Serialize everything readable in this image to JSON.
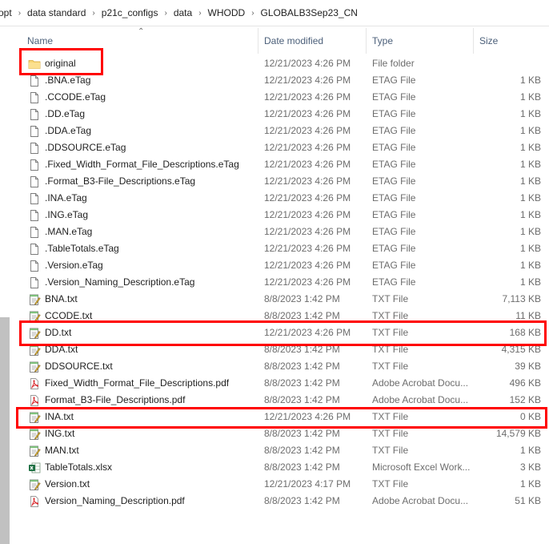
{
  "breadcrumb": [
    "opt",
    "data standard",
    "p21c_configs",
    "data",
    "WHODD",
    "GLOBALB3Sep23_CN"
  ],
  "columns": {
    "name": "Name",
    "date": "Date modified",
    "type": "Type",
    "size": "Size"
  },
  "icons": {
    "folder": "folder-icon",
    "file": "file-icon",
    "txt": "notepad-icon",
    "pdf": "pdf-icon",
    "xlsx": "excel-icon",
    "separator": "chevron-right-icon",
    "sort": "sort-up-icon"
  },
  "colors": {
    "highlight": "#ff0000",
    "folder": "#f8d775",
    "pdf": "#d8262b",
    "excel": "#1d6f42",
    "header_text": "#4c607a"
  },
  "files": [
    {
      "name": "original",
      "date": "12/21/2023 4:26 PM",
      "type": "File folder",
      "size": "",
      "icon": "folder"
    },
    {
      "name": ".BNA.eTag",
      "date": "12/21/2023 4:26 PM",
      "type": "ETAG File",
      "size": "1 KB",
      "icon": "file"
    },
    {
      "name": ".CCODE.eTag",
      "date": "12/21/2023 4:26 PM",
      "type": "ETAG File",
      "size": "1 KB",
      "icon": "file"
    },
    {
      "name": ".DD.eTag",
      "date": "12/21/2023 4:26 PM",
      "type": "ETAG File",
      "size": "1 KB",
      "icon": "file"
    },
    {
      "name": ".DDA.eTag",
      "date": "12/21/2023 4:26 PM",
      "type": "ETAG File",
      "size": "1 KB",
      "icon": "file"
    },
    {
      "name": ".DDSOURCE.eTag",
      "date": "12/21/2023 4:26 PM",
      "type": "ETAG File",
      "size": "1 KB",
      "icon": "file"
    },
    {
      "name": ".Fixed_Width_Format_File_Descriptions.eTag",
      "date": "12/21/2023 4:26 PM",
      "type": "ETAG File",
      "size": "1 KB",
      "icon": "file"
    },
    {
      "name": ".Format_B3-File_Descriptions.eTag",
      "date": "12/21/2023 4:26 PM",
      "type": "ETAG File",
      "size": "1 KB",
      "icon": "file"
    },
    {
      "name": ".INA.eTag",
      "date": "12/21/2023 4:26 PM",
      "type": "ETAG File",
      "size": "1 KB",
      "icon": "file"
    },
    {
      "name": ".ING.eTag",
      "date": "12/21/2023 4:26 PM",
      "type": "ETAG File",
      "size": "1 KB",
      "icon": "file"
    },
    {
      "name": ".MAN.eTag",
      "date": "12/21/2023 4:26 PM",
      "type": "ETAG File",
      "size": "1 KB",
      "icon": "file"
    },
    {
      "name": ".TableTotals.eTag",
      "date": "12/21/2023 4:26 PM",
      "type": "ETAG File",
      "size": "1 KB",
      "icon": "file"
    },
    {
      "name": ".Version.eTag",
      "date": "12/21/2023 4:26 PM",
      "type": "ETAG File",
      "size": "1 KB",
      "icon": "file"
    },
    {
      "name": ".Version_Naming_Description.eTag",
      "date": "12/21/2023 4:26 PM",
      "type": "ETAG File",
      "size": "1 KB",
      "icon": "file"
    },
    {
      "name": "BNA.txt",
      "date": "8/8/2023 1:42 PM",
      "type": "TXT File",
      "size": "7,113 KB",
      "icon": "txt"
    },
    {
      "name": "CCODE.txt",
      "date": "8/8/2023 1:42 PM",
      "type": "TXT File",
      "size": "11 KB",
      "icon": "txt"
    },
    {
      "name": "DD.txt",
      "date": "12/21/2023 4:26 PM",
      "type": "TXT File",
      "size": "168 KB",
      "icon": "txt"
    },
    {
      "name": "DDA.txt",
      "date": "8/8/2023 1:42 PM",
      "type": "TXT File",
      "size": "4,315 KB",
      "icon": "txt"
    },
    {
      "name": "DDSOURCE.txt",
      "date": "8/8/2023 1:42 PM",
      "type": "TXT File",
      "size": "39 KB",
      "icon": "txt"
    },
    {
      "name": "Fixed_Width_Format_File_Descriptions.pdf",
      "date": "8/8/2023 1:42 PM",
      "type": "Adobe Acrobat Docu...",
      "size": "496 KB",
      "icon": "pdf"
    },
    {
      "name": "Format_B3-File_Descriptions.pdf",
      "date": "8/8/2023 1:42 PM",
      "type": "Adobe Acrobat Docu...",
      "size": "152 KB",
      "icon": "pdf"
    },
    {
      "name": "INA.txt",
      "date": "12/21/2023 4:26 PM",
      "type": "TXT File",
      "size": "0 KB",
      "icon": "txt"
    },
    {
      "name": "ING.txt",
      "date": "8/8/2023 1:42 PM",
      "type": "TXT File",
      "size": "14,579 KB",
      "icon": "txt"
    },
    {
      "name": "MAN.txt",
      "date": "8/8/2023 1:42 PM",
      "type": "TXT File",
      "size": "1 KB",
      "icon": "txt"
    },
    {
      "name": "TableTotals.xlsx",
      "date": "8/8/2023 1:42 PM",
      "type": "Microsoft Excel Work...",
      "size": "3 KB",
      "icon": "xlsx"
    },
    {
      "name": "Version.txt",
      "date": "12/21/2023 4:17 PM",
      "type": "TXT File",
      "size": "1 KB",
      "icon": "txt"
    },
    {
      "name": "Version_Naming_Description.pdf",
      "date": "8/8/2023 1:42 PM",
      "type": "Adobe Acrobat Docu...",
      "size": "51 KB",
      "icon": "pdf"
    }
  ]
}
